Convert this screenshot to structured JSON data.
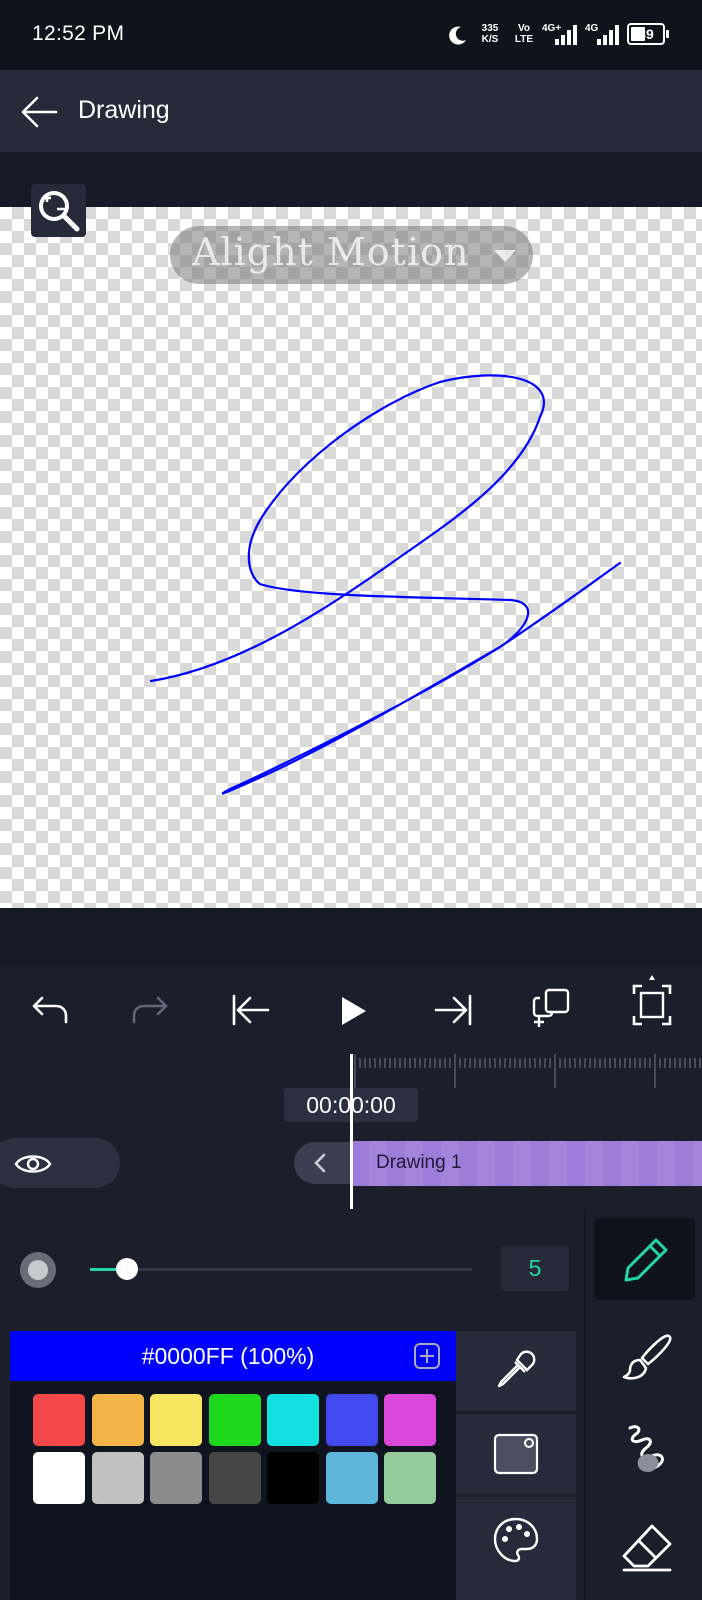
{
  "status_bar": {
    "time": "12:52 PM",
    "net_speed_value": "335",
    "net_speed_unit": "K/S",
    "volte_top": "Vo",
    "volte_bottom": "LTE",
    "sim1_label": "4G+",
    "sim2_label": "4G",
    "battery": "39"
  },
  "app_bar": {
    "title": "Drawing"
  },
  "canvas": {
    "watermark": "Alight Motion",
    "stroke_color": "#0000ff"
  },
  "timeline": {
    "timecode": "00:00:00",
    "clip_label": "Drawing 1"
  },
  "brush": {
    "size": "5",
    "size_fraction": 0.05
  },
  "color": {
    "label": "#0000FF (100%)",
    "current": "#0000ff",
    "swatches": [
      "#f44747",
      "#f4b347",
      "#f9e660",
      "#1fd91f",
      "#12e0e0",
      "#4149ef",
      "#dc47dc",
      "#ffffff",
      "#c1c1c1",
      "#8c8c8c",
      "#464646",
      "#000000",
      "#5db5dc",
      "#96cb9d"
    ]
  },
  "theme": {
    "accent": "#24d6a6",
    "panel": "#262a3b",
    "background": "#161a26",
    "clip": "#9d7bd8"
  },
  "icons": {
    "back": "back-arrow-icon",
    "zoom": "zoom-icon",
    "undo": "undo-icon",
    "redo": "redo-icon",
    "start": "skip-to-start-icon",
    "play": "play-icon",
    "end": "skip-to-end-icon",
    "duplicate": "duplicate-icon",
    "fit": "fit-screen-icon",
    "eye": "eye-icon",
    "eyedropper": "eyedropper-icon",
    "canvas": "canvas-color-icon",
    "palette": "palette-icon",
    "pencil": "pencil-icon",
    "brush": "brush-icon",
    "smudge": "smudge-icon",
    "eraser": "eraser-icon"
  }
}
